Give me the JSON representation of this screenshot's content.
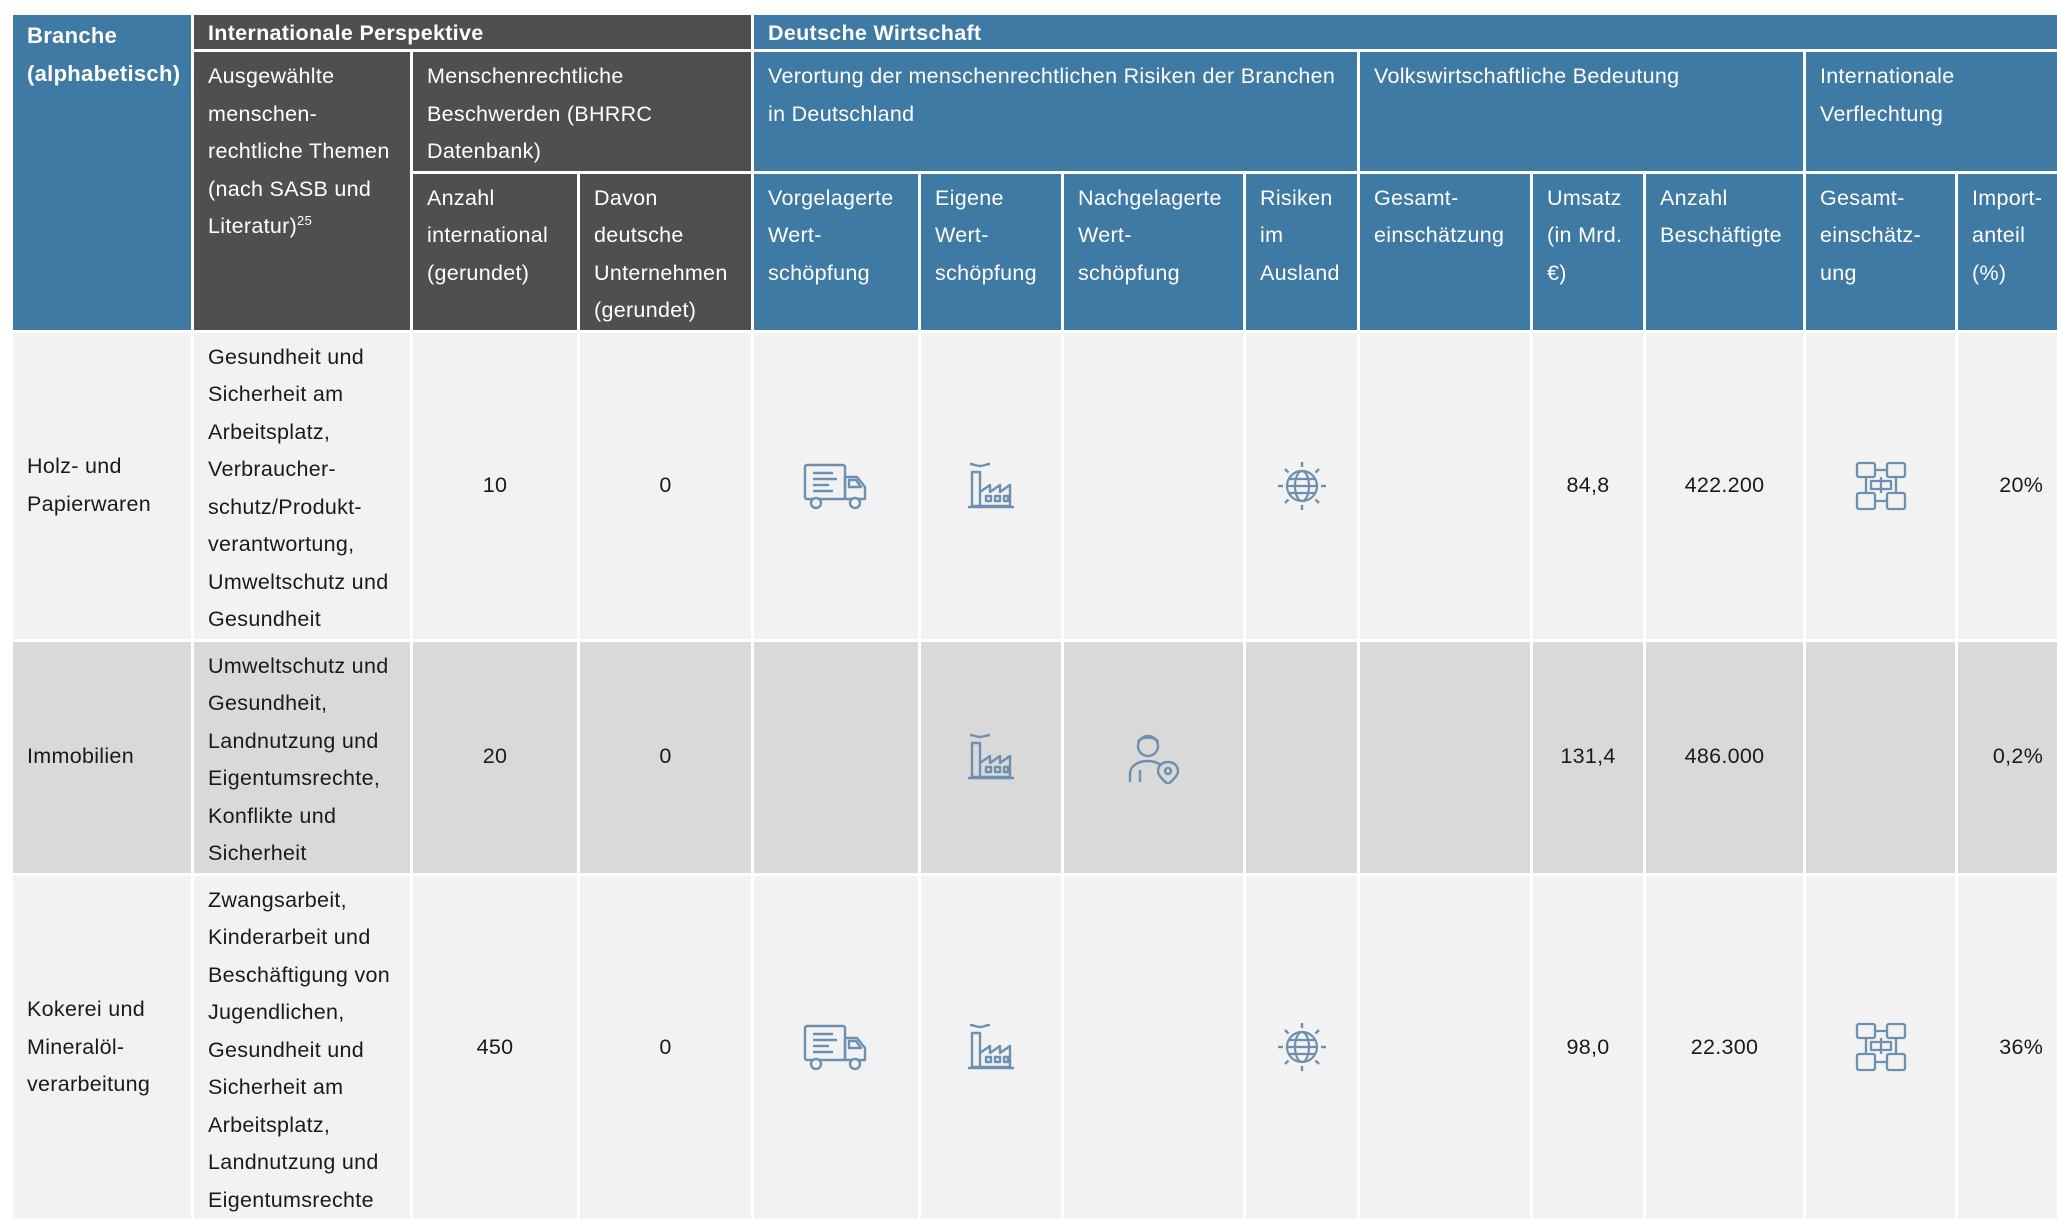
{
  "header": {
    "branche": "Branche (alphabetisch)",
    "international_perspective": "Internationale Perspektive",
    "deutsche_wirtschaft": "Deutsche Wirtschaft",
    "ausgewaehlte_themen": "Ausgewählte menschen-rechtliche Themen (nach SASB und Literatur)",
    "ausgewaehlte_themen_footnote": "25",
    "beschwerden": "Menschenrechtliche Beschwerden (BHRRC Datenbank)",
    "verortung": "Verortung der menschenrechtlichen  Risiken der Branchen in Deutschland",
    "volkswirtschaft": "Volkswirtschaftliche Bedeutung",
    "verflechtung": "Internationale Verflechtung",
    "anzahl_international": "Anzahl international (gerundet)",
    "davon_deutsche": "Davon deutsche Unternehmen (gerundet)",
    "vorgelagerte": "Vorgelagerte Wert-schöpfung",
    "eigene": "Eigene Wert-schöpfung",
    "nachgelagerte": "Nachgelagerte Wert-schöpfung",
    "risiken_ausland": "Risiken im Ausland",
    "gesamteinschaetzung_vw": "Gesamt-einschätzung",
    "umsatz": "Umsatz (in Mrd. €)",
    "beschaeftigte": "Anzahl Beschäftigte",
    "gesamteinschaetzung_iv": "Gesamt-einschätz-ung",
    "importanteil": "Import-anteil (%)"
  },
  "rows": [
    {
      "branche": "Holz- und Papierwaren",
      "themen": "Gesundheit und Sicherheit am Arbeitsplatz, Verbraucher-schutz/Produkt-verantwortung, Umweltschutz und Gesundheit",
      "anzahl": "10",
      "davon": "0",
      "icons": {
        "vorgelagert": "truck-icon",
        "eigene": "factory-icon",
        "nachgelagert": "",
        "ausland": "globe-icon",
        "verflechtung": "network-icon"
      },
      "umsatz": "84,8",
      "beschaeftigte": "422.200",
      "import": "20%"
    },
    {
      "branche": "Immobilien",
      "themen": "Umweltschutz und Gesundheit, Landnutzung und Eigentumsrechte, Konflikte und Sicherheit",
      "anzahl": "20",
      "davon": "0",
      "icons": {
        "vorgelagert": "",
        "eigene": "factory-icon",
        "nachgelagert": "person-location-icon",
        "ausland": "",
        "verflechtung": ""
      },
      "umsatz": "131,4",
      "beschaeftigte": "486.000",
      "import": "0,2%"
    },
    {
      "branche": "Kokerei und Mineralöl-verarbeitung",
      "themen": "Zwangsarbeit, Kinderarbeit und Beschäftigung von Jugendlichen, Gesundheit und Sicherheit am Arbeitsplatz, Landnutzung und Eigentumsrechte",
      "anzahl": "450",
      "davon": "0",
      "icons": {
        "vorgelagert": "truck-icon",
        "eigene": "factory-icon",
        "nachgelagert": "",
        "ausland": "globe-icon",
        "verflechtung": "network-icon"
      },
      "umsatz": "98,0",
      "beschaeftigte": "22.300",
      "import": "36%"
    }
  ],
  "colors": {
    "header_dark": "#4f4f4f",
    "header_blue": "#3e7aa3",
    "row_light": "#f2f2f2",
    "row_grey": "#d9d9d9",
    "icon": "#6d8fb0"
  }
}
